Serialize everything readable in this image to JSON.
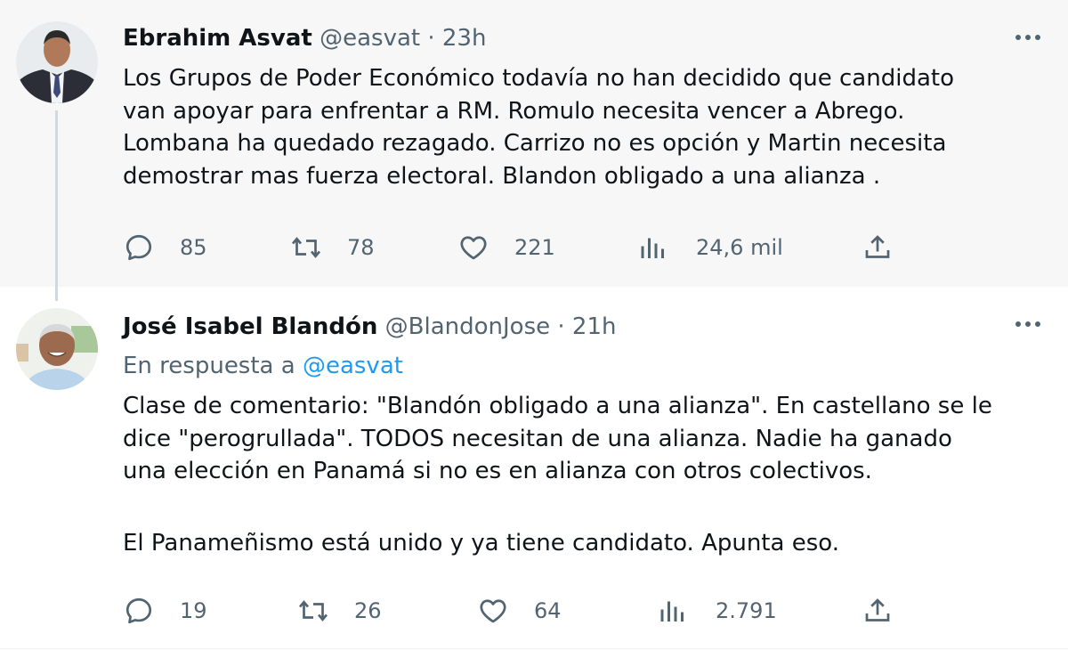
{
  "tweets": [
    {
      "author_name": "Ebrahim Asvat",
      "handle": "@easvat",
      "time": "23h",
      "body_lines": [
        "Los Grupos de Poder Económico todavía no han decidido que candidato",
        "van apoyar para enfrentar a RM.  Romulo necesita vencer a Abrego.",
        "Lombana ha quedado rezagado. Carrizo no es opción y Martin necesita",
        "demostrar mas fuerza electoral.  Blandon obligado a una alianza ."
      ],
      "replies": "85",
      "retweets": "78",
      "likes": "221",
      "views": "24,6 mil"
    },
    {
      "author_name": "José Isabel Blandón",
      "handle": "@BlandonJose",
      "time": "21h",
      "reply_prefix": "En respuesta a",
      "reply_mention": "@easvat",
      "body_lines": [
        "Clase de comentario: \"Blandón obligado a una alianza\". En castellano se le",
        "dice \"perogrullada\". TODOS necesitan de una alianza. Nadie ha ganado",
        "una elección en Panamá si no es en alianza con otros colectivos.",
        "",
        "El Panameñismo está unido y ya tiene candidato. Apunta eso."
      ],
      "replies": "19",
      "retweets": "26",
      "likes": "64",
      "views": "2.791"
    }
  ],
  "separator": "·",
  "colors": {
    "text_primary": "#0f1419",
    "text_secondary": "#536471",
    "link": "#1d9bf0",
    "thread_line": "#cfd9de",
    "highlight_bg": "#f7f7f7"
  },
  "icons": [
    "more-icon",
    "reply-icon",
    "retweet-icon",
    "like-icon",
    "views-icon",
    "share-icon"
  ]
}
